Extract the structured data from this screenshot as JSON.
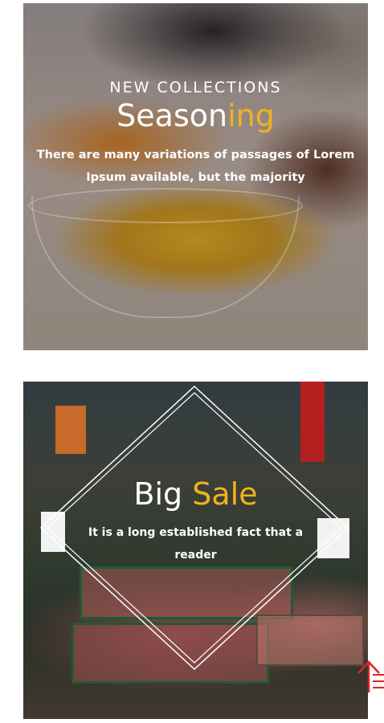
{
  "banners": [
    {
      "kicker": "NEW COLLECTIONS",
      "title_main": "Season",
      "title_accent": "ing",
      "description": "There are many variations of passages of Lorem Ipsum available, but the majority"
    },
    {
      "title_main": "Big",
      "title_accent": "Sale",
      "description": "It is a long established fact that a reader"
    }
  ],
  "colors": {
    "accent": "#f1b21c",
    "text": "#ffffff",
    "scroll_top": "#e02424"
  },
  "icons": {
    "scroll_top": "double-up-arrow-icon"
  }
}
